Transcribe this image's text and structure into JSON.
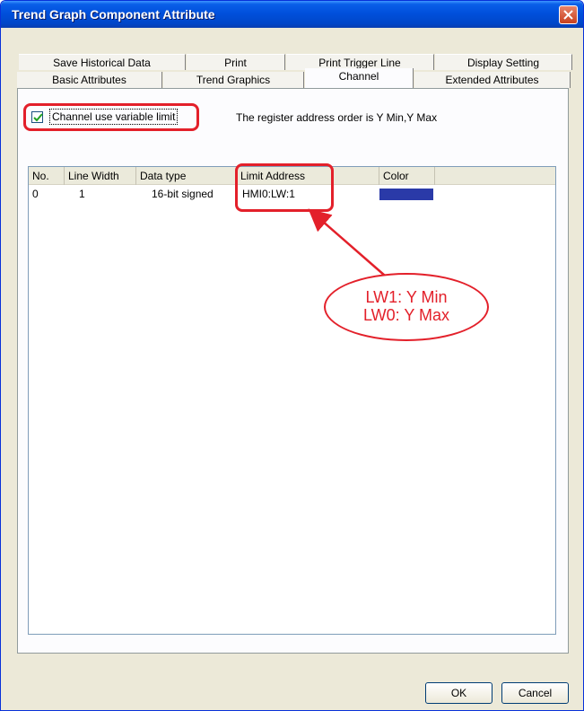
{
  "window": {
    "title": "Trend Graph Component Attribute"
  },
  "tabs": {
    "back_row": [
      "Save Historical Data",
      "Print",
      "Print Trigger Line",
      "Display Setting"
    ],
    "front_row": [
      "Basic Attributes",
      "Trend Graphics",
      "Channel",
      "Extended Attributes"
    ],
    "active": "Channel"
  },
  "channel": {
    "checkbox_label": "Channel use variable limit",
    "checkbox_checked": true,
    "hint": "The register address order is Y Min,Y Max"
  },
  "list": {
    "columns": [
      "No.",
      "Line Width",
      "Data type",
      "Limit Address",
      "Color"
    ],
    "rows": [
      {
        "no": "0",
        "line_width": "1",
        "data_type": "16-bit signed",
        "limit_address": "HMI0:LW:1",
        "color": "#2a3aa8"
      }
    ]
  },
  "annotation": {
    "line1": "LW1: Y Min",
    "line2": "LW0: Y Max",
    "color": "#e3202a"
  },
  "buttons": {
    "ok": "OK",
    "cancel": "Cancel"
  },
  "colors": {
    "titlebar": "#0050dc",
    "dialog_bg": "#ece9d8",
    "highlight": "#e3202a"
  }
}
